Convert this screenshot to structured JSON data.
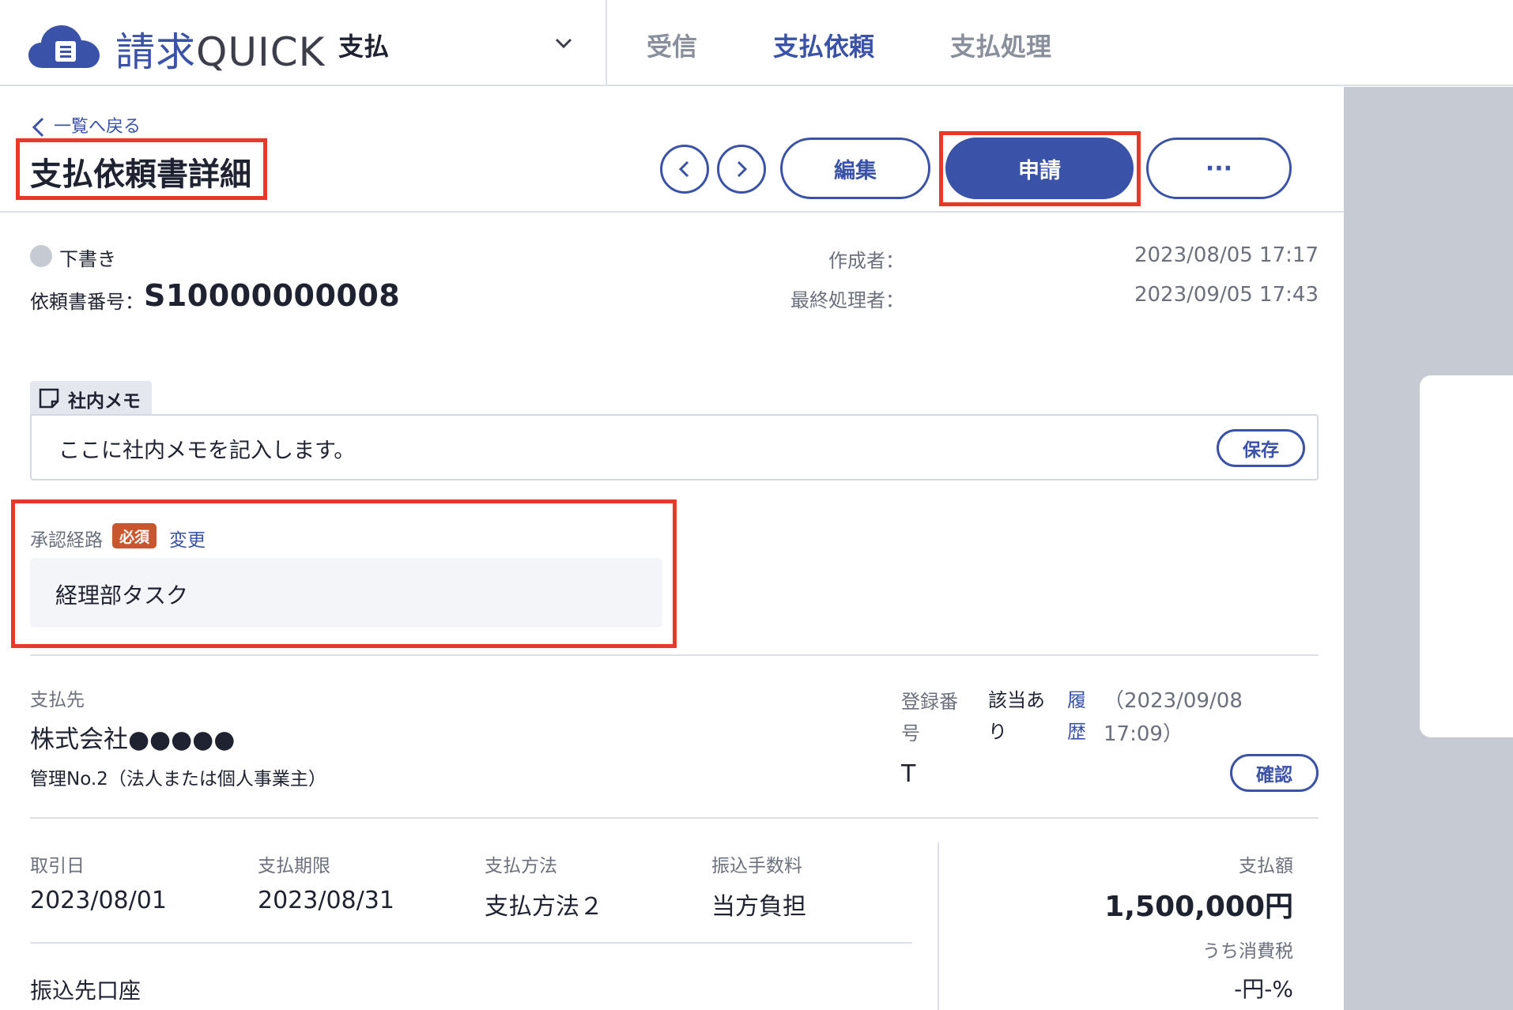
{
  "header": {
    "brand_mark": "請求",
    "brand_text": "QUICK",
    "module": "支払",
    "tabs": [
      {
        "label": "受信",
        "active": false
      },
      {
        "label": "支払依頼",
        "active": true
      },
      {
        "label": "支払処理",
        "active": false
      }
    ]
  },
  "page": {
    "back_label": "一覧へ戻る",
    "title": "支払依頼書詳細"
  },
  "toolbar": {
    "prev_icon": "chevron-left-icon",
    "next_icon": "chevron-right-icon",
    "edit_label": "編集",
    "apply_label": "申請",
    "more_label": "···"
  },
  "status": {
    "label": "下書き",
    "request_number_label": "依頼書番号：",
    "request_number": "S10000000008",
    "creator_label": "作成者：",
    "created_at": "2023/08/05 17:17",
    "last_processor_label": "最終処理者：",
    "processed_at": "2023/09/05 17:43"
  },
  "memo": {
    "tab_label": "社内メモ",
    "value": "ここに社内メモを記入します。",
    "save_label": "保存"
  },
  "approval": {
    "label": "承認経路",
    "required_badge": "必須",
    "change_label": "変更",
    "route": "経理部タスク"
  },
  "vendor": {
    "label": "支払先",
    "name": "株式会社●●●●●",
    "sub": "管理No.2（法人または個人事業主）",
    "reg_label": "登録番号",
    "reg_status": "該当あり",
    "history_link": "履歴",
    "history_date": "（2023/09/08 17:09）",
    "reg_number": "T",
    "confirm_label": "確認"
  },
  "details": {
    "fields": [
      {
        "label": "取引日",
        "value": "2023/08/01"
      },
      {
        "label": "支払期限",
        "value": "2023/08/31"
      },
      {
        "label": "支払方法",
        "value": "支払方法２"
      },
      {
        "label": "振込手数料",
        "value": "当方負担"
      }
    ],
    "amount_label": "支払額",
    "amount": "1,500,000円",
    "tax_label": "うち消費税",
    "tax": "-円-%",
    "account_label": "振込先口座"
  },
  "colors": {
    "accent": "#3a52a8",
    "highlight": "#e8382a",
    "required": "#c9562c"
  }
}
